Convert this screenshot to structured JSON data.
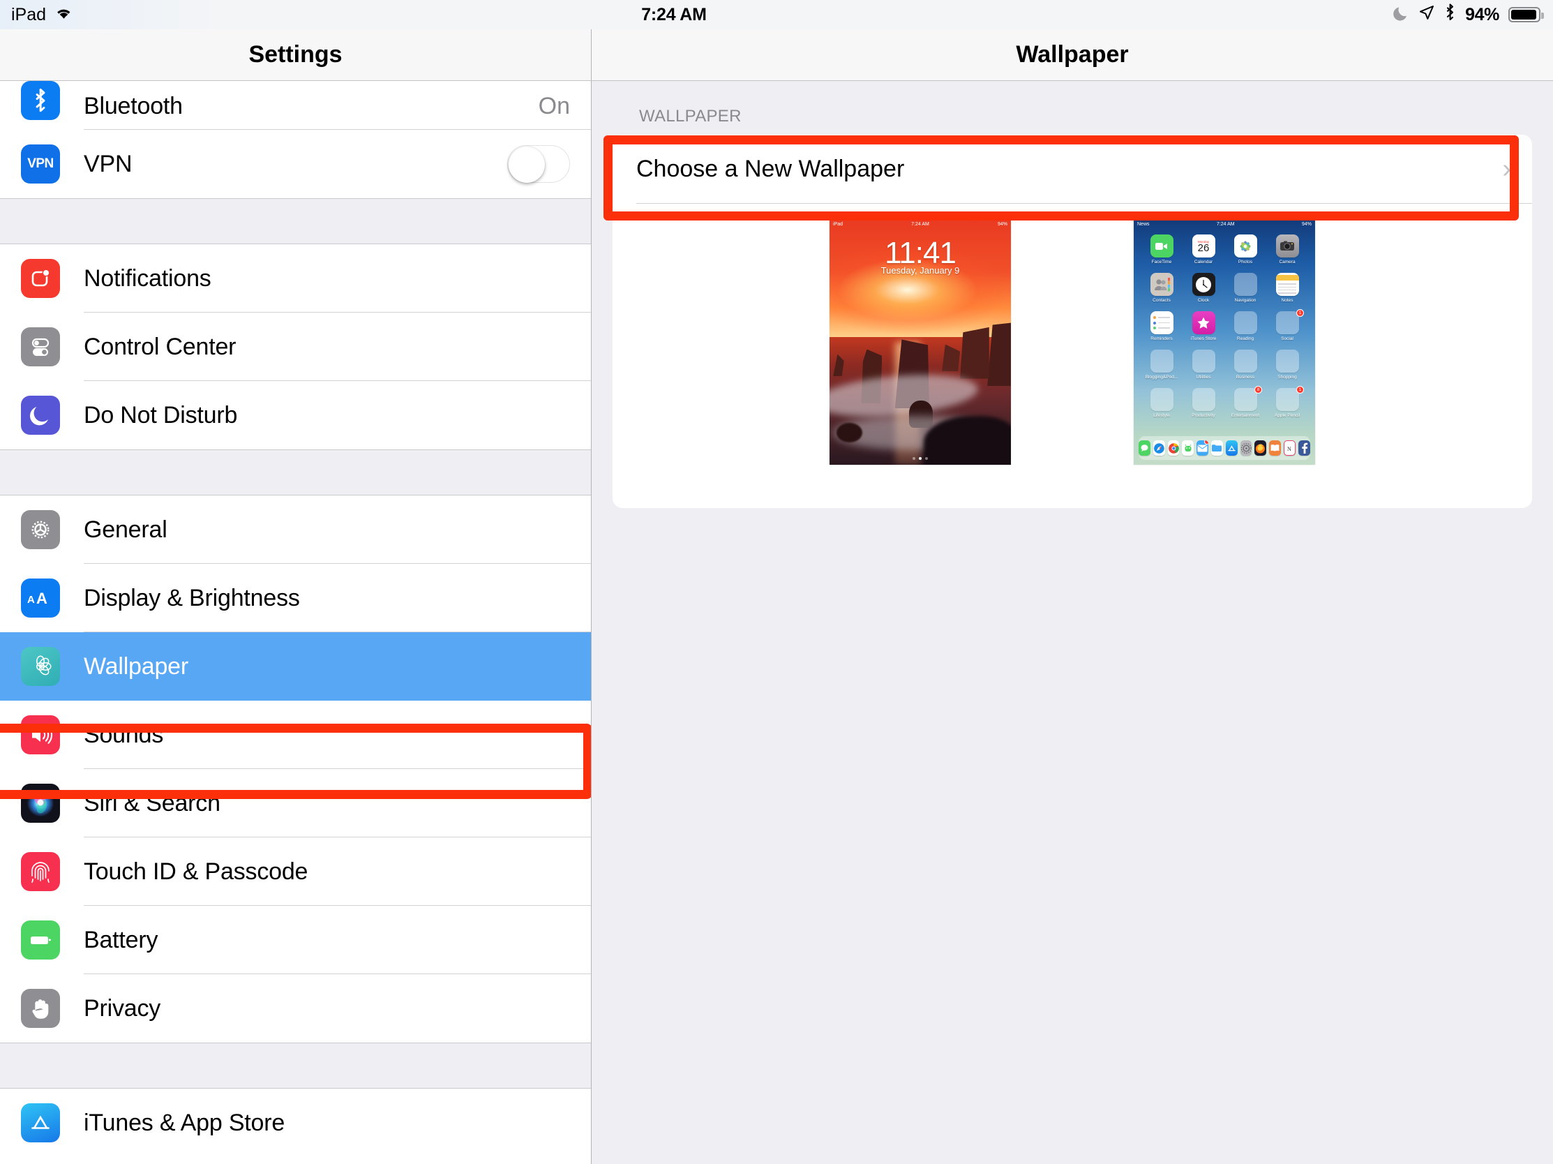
{
  "status_bar": {
    "device": "iPad",
    "wifi_icon": "wifi-icon",
    "time": "7:24 AM",
    "moon_icon": "moon-icon",
    "location_icon": "location-arrow-icon",
    "bluetooth_icon": "bluetooth-icon",
    "battery_percent": "94%",
    "battery_icon": "battery-icon"
  },
  "sidebar": {
    "title": "Settings",
    "groups": [
      {
        "items": [
          {
            "label": "Bluetooth",
            "value": "On",
            "icon": "bluetooth-icon",
            "accessory": "value"
          },
          {
            "label": "VPN",
            "value": "",
            "icon": "vpn-icon",
            "accessory": "toggle",
            "toggle_on": false
          }
        ]
      },
      {
        "items": [
          {
            "label": "Notifications",
            "value": "",
            "icon": "notifications-icon",
            "accessory": "none"
          },
          {
            "label": "Control Center",
            "value": "",
            "icon": "control-center-icon",
            "accessory": "none"
          },
          {
            "label": "Do Not Disturb",
            "value": "",
            "icon": "moon-icon",
            "accessory": "none"
          }
        ]
      },
      {
        "items": [
          {
            "label": "General",
            "value": "",
            "icon": "gear-icon",
            "accessory": "none"
          },
          {
            "label": "Display & Brightness",
            "value": "",
            "icon": "text-size-icon",
            "accessory": "none"
          },
          {
            "label": "Wallpaper",
            "value": "",
            "icon": "flower-icon",
            "accessory": "none",
            "selected": true
          },
          {
            "label": "Sounds",
            "value": "",
            "icon": "speaker-icon",
            "accessory": "none"
          },
          {
            "label": "Siri & Search",
            "value": "",
            "icon": "siri-icon",
            "accessory": "none"
          },
          {
            "label": "Touch ID & Passcode",
            "value": "",
            "icon": "fingerprint-icon",
            "accessory": "none"
          },
          {
            "label": "Battery",
            "value": "",
            "icon": "battery-icon",
            "accessory": "none"
          },
          {
            "label": "Privacy",
            "value": "",
            "icon": "hand-icon",
            "accessory": "none"
          }
        ]
      },
      {
        "items": [
          {
            "label": "iTunes & App Store",
            "value": "",
            "icon": "app-store-icon",
            "accessory": "none"
          }
        ]
      }
    ]
  },
  "detail": {
    "title": "Wallpaper",
    "section_header": "WALLPAPER",
    "choose_row": {
      "label": "Choose a New Wallpaper",
      "chevron_icon": "chevron-right-icon"
    },
    "previews": {
      "lock_screen": {
        "name": "lock-screen-preview",
        "status_device": "iPad",
        "status_time": "7:24 AM",
        "status_battery": "94%",
        "clock": "11:41",
        "date": "Tuesday, January 9"
      },
      "home_screen": {
        "name": "home-screen-preview",
        "status_device": "News",
        "status_time": "7:24 AM",
        "status_battery": "94%",
        "apps": [
          {
            "name": "FaceTime",
            "badge": ""
          },
          {
            "name": "Calendar",
            "badge": "",
            "cal_weekday": "Monday",
            "cal_day": "26"
          },
          {
            "name": "Photos",
            "badge": ""
          },
          {
            "name": "Camera",
            "badge": ""
          },
          {
            "name": "Contacts",
            "badge": ""
          },
          {
            "name": "Clock",
            "badge": ""
          },
          {
            "name": "Navigation",
            "badge": ""
          },
          {
            "name": "Notes",
            "badge": ""
          },
          {
            "name": "Reminders",
            "badge": ""
          },
          {
            "name": "iTunes Store",
            "badge": ""
          },
          {
            "name": "Reading",
            "badge": ""
          },
          {
            "name": "Social",
            "badge": "1"
          },
          {
            "name": "Blogging&Pod...",
            "badge": ""
          },
          {
            "name": "Utilities",
            "badge": ""
          },
          {
            "name": "Business",
            "badge": ""
          },
          {
            "name": "Shopping",
            "badge": ""
          },
          {
            "name": "Lifestyle",
            "badge": ""
          },
          {
            "name": "Productivity",
            "badge": ""
          },
          {
            "name": "Entertainment",
            "badge": "8"
          },
          {
            "name": "Apple Pencil",
            "badge": "1"
          }
        ],
        "dock": [
          {
            "name": "Messages",
            "badge": false
          },
          {
            "name": "Safari",
            "badge": false
          },
          {
            "name": "Chrome",
            "badge": false
          },
          {
            "name": "Android Robot",
            "badge": false
          },
          {
            "name": "Mail",
            "badge": true
          },
          {
            "name": "Files",
            "badge": false
          },
          {
            "name": "App Store",
            "badge": false
          },
          {
            "name": "Settings",
            "badge": false
          },
          {
            "name": "Firefox",
            "badge": false
          },
          {
            "name": "Books",
            "badge": false
          },
          {
            "name": "Notability",
            "badge": false
          },
          {
            "name": "Facebook",
            "badge": false
          }
        ]
      }
    }
  },
  "annotations": {
    "highlight_color": "#fb2f09",
    "boxes": [
      {
        "name": "choose-wallpaper-highlight"
      },
      {
        "name": "wallpaper-sidebar-highlight"
      }
    ]
  },
  "colors": {
    "selection_blue": "#57a7f4",
    "panel_bg": "#eeeef3",
    "card_bg": "#ffffff",
    "secondary_text": "#8a8a8e"
  }
}
